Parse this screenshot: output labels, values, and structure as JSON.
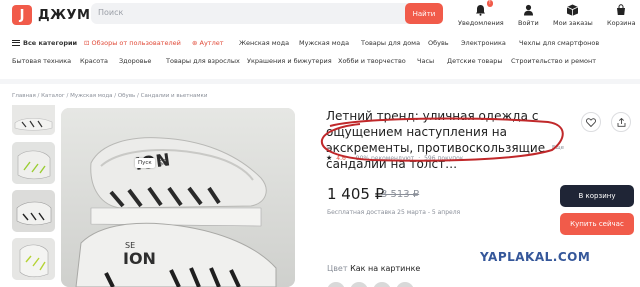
{
  "header": {
    "logo_letter": "J",
    "logo_text": "ДЖУМ",
    "search_placeholder": "Поиск",
    "search_button": "Найти",
    "actions": [
      {
        "label": "Уведомления",
        "icon": "bell-icon",
        "badge": "!"
      },
      {
        "label": "Войти",
        "icon": "user-icon"
      },
      {
        "label": "Мои заказы",
        "icon": "orders-icon"
      },
      {
        "label": "Корзина",
        "icon": "cart-icon"
      }
    ]
  },
  "categories": {
    "row1": [
      "Все категории",
      "Обзоры от пользователей",
      "Аутлет",
      "Женская мода",
      "Мужская мода",
      "Товары для дома",
      "Обувь",
      "Электроника",
      "Чехлы для смартфонов"
    ],
    "row2": [
      "Бытовая техника",
      "Красота",
      "Здоровье",
      "Товары для взрослых",
      "Украшения и бижутерия",
      "Хобби и творчество",
      "Часы",
      "Детские товары",
      "Строительство и ремонт"
    ]
  },
  "breadcrumbs": "Главная / Каталог / Мужская мода / Обувь / Сандалии и вьетнамки",
  "gallery": {
    "hint": "Пуск"
  },
  "product": {
    "title": "Летний тренд: уличная одежда с ощущением наступления на экскременты, противоскользящие сандалии на толст…",
    "more": "Еще",
    "rating": "4.6",
    "recommend": "90% рекомендуют",
    "purchases": "596 покупок",
    "price": "1 405 ₽",
    "old_price": "3 513 ₽",
    "delivery": "Бесплатная доставка 25 марта - 5 апреля",
    "cart_button": "В корзину",
    "buy_button": "Купить сейчас",
    "color_label": "Цвет",
    "color_value": "Как на картинке"
  },
  "watermark": "YAPLAKAL.COM",
  "colors": {
    "accent": "#f15b4a",
    "dark_button": "#1f2536",
    "annotation": "#c0282a",
    "watermark": "#35579a"
  }
}
